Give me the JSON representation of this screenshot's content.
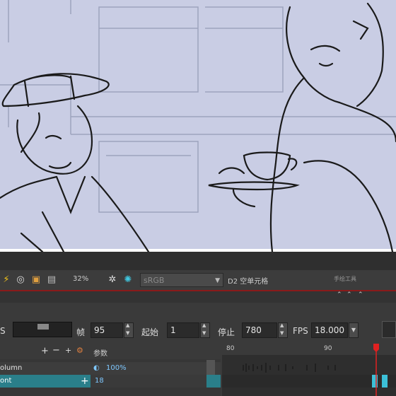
{
  "toolbar": {
    "zoom": "32%",
    "color_space": "sRGB",
    "label_d2": "D2 空单元格",
    "label_right": "手绘工具"
  },
  "timebar": {
    "frames_label": "帧",
    "frames_value": "95",
    "start_label": "起始",
    "start_value": "1",
    "stop_label": "停止",
    "stop_value": "780",
    "fps_label": "FPS",
    "fps_value": "18.000",
    "s_label": "S"
  },
  "layers": {
    "params_label": "参数",
    "rows": [
      {
        "name": "olumn",
        "value": "100%"
      },
      {
        "name": "ont",
        "value": "18"
      }
    ]
  },
  "timeline": {
    "ticks": [
      "80",
      "90"
    ]
  }
}
